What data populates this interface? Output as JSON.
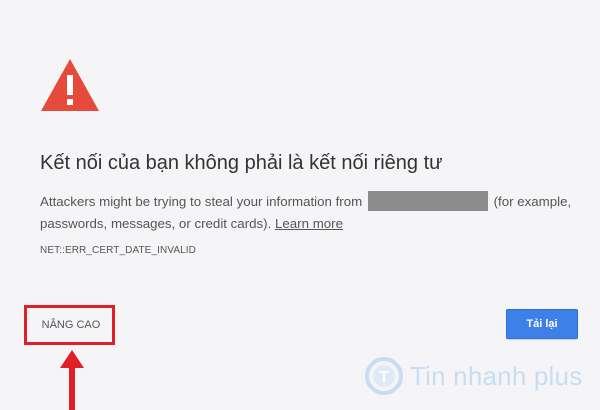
{
  "page": {
    "title": "Kết nối của bạn không phải là kết nối riêng tư",
    "description_before": "Attackers might be trying to steal your information from ",
    "description_after": " (for example, passwords, messages, or credit cards). ",
    "learn_more": "Learn more",
    "error_code": "NET::ERR_CERT_DATE_INVALID"
  },
  "actions": {
    "advanced_label": "NÂNG CAO",
    "reload_label": "Tải lại"
  },
  "watermark": {
    "text": "Tin nhanh plus",
    "logo_letter": "T"
  },
  "colors": {
    "warning_red": "#e64a3b",
    "highlight_red": "#e01f26",
    "primary_blue": "#3d80e8",
    "redacted_gray": "#8c8c8c",
    "watermark_blue": "#c7ddf2"
  },
  "icons": {
    "warning": "warning-triangle-icon",
    "annotation_arrow": "arrow-up-icon",
    "watermark_logo": "watermark-logo-icon"
  }
}
